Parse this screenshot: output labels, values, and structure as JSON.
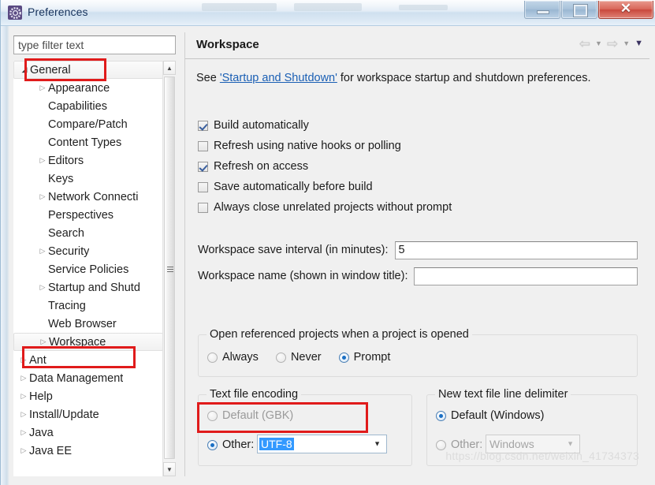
{
  "window": {
    "title": "Preferences",
    "icon": "eclipse-gear-icon",
    "buttons": {
      "minimize": "minimize-button",
      "maximize": "maximize-button",
      "close": "✕"
    }
  },
  "filter": {
    "placeholder": "type filter text",
    "value": ""
  },
  "tree": {
    "items": [
      {
        "label": "General",
        "depth": 0,
        "arrow": "expanded",
        "selected": true,
        "annotated": true
      },
      {
        "label": "Appearance",
        "depth": 1,
        "arrow": "collapsed",
        "selected": false,
        "annotated": false
      },
      {
        "label": "Capabilities",
        "depth": 1,
        "arrow": "none",
        "selected": false,
        "annotated": false
      },
      {
        "label": "Compare/Patch",
        "depth": 1,
        "arrow": "none",
        "selected": false,
        "annotated": false
      },
      {
        "label": "Content Types",
        "depth": 1,
        "arrow": "none",
        "selected": false,
        "annotated": false
      },
      {
        "label": "Editors",
        "depth": 1,
        "arrow": "collapsed",
        "selected": false,
        "annotated": false
      },
      {
        "label": "Keys",
        "depth": 1,
        "arrow": "none",
        "selected": false,
        "annotated": false
      },
      {
        "label": "Network Connecti",
        "depth": 1,
        "arrow": "collapsed",
        "selected": false,
        "annotated": false
      },
      {
        "label": "Perspectives",
        "depth": 1,
        "arrow": "none",
        "selected": false,
        "annotated": false
      },
      {
        "label": "Search",
        "depth": 1,
        "arrow": "none",
        "selected": false,
        "annotated": false
      },
      {
        "label": "Security",
        "depth": 1,
        "arrow": "collapsed",
        "selected": false,
        "annotated": false
      },
      {
        "label": "Service Policies",
        "depth": 1,
        "arrow": "none",
        "selected": false,
        "annotated": false
      },
      {
        "label": "Startup and Shutd",
        "depth": 1,
        "arrow": "collapsed",
        "selected": false,
        "annotated": false
      },
      {
        "label": "Tracing",
        "depth": 1,
        "arrow": "none",
        "selected": false,
        "annotated": false
      },
      {
        "label": "Web Browser",
        "depth": 1,
        "arrow": "none",
        "selected": false,
        "annotated": false
      },
      {
        "label": "Workspace",
        "depth": 1,
        "arrow": "collapsed",
        "selected": true,
        "annotated": true
      },
      {
        "label": "Ant",
        "depth": 0,
        "arrow": "collapsed",
        "selected": false,
        "annotated": false
      },
      {
        "label": "Data Management",
        "depth": 0,
        "arrow": "collapsed",
        "selected": false,
        "annotated": false
      },
      {
        "label": "Help",
        "depth": 0,
        "arrow": "collapsed",
        "selected": false,
        "annotated": false
      },
      {
        "label": "Install/Update",
        "depth": 0,
        "arrow": "collapsed",
        "selected": false,
        "annotated": false
      },
      {
        "label": "Java",
        "depth": 0,
        "arrow": "collapsed",
        "selected": false,
        "annotated": false
      },
      {
        "label": "Java EE",
        "depth": 0,
        "arrow": "collapsed",
        "selected": false,
        "annotated": false
      }
    ]
  },
  "panel": {
    "title": "Workspace",
    "nav": {
      "back": "⇦",
      "back_caret": "▼",
      "forward": "⇨",
      "forward_caret": "▼",
      "menu_caret": "▼"
    },
    "see_prefix": "See ",
    "see_link": "'Startup and Shutdown'",
    "see_suffix": " for workspace startup and shutdown preferences.",
    "checkboxes": [
      {
        "label": "Build automatically",
        "checked": true
      },
      {
        "label": "Refresh using native hooks or polling",
        "checked": false
      },
      {
        "label": "Refresh on access",
        "checked": true
      },
      {
        "label": "Save automatically before build",
        "checked": false
      },
      {
        "label": "Always close unrelated projects without prompt",
        "checked": false
      }
    ],
    "fields": [
      {
        "label": "Workspace save interval (in minutes):",
        "value": "5"
      },
      {
        "label": "Workspace name (shown in window title):",
        "value": ""
      }
    ],
    "open_referenced": {
      "title": "Open referenced projects when a project is opened",
      "options": [
        {
          "label": "Always",
          "selected": false
        },
        {
          "label": "Never",
          "selected": false
        },
        {
          "label": "Prompt",
          "selected": true
        }
      ]
    },
    "text_file_encoding": {
      "title": "Text file encoding",
      "default_label": "Default (GBK)",
      "default_selected": false,
      "other_label": "Other:",
      "other_selected": true,
      "other_value": "UTF-8",
      "annotated": true
    },
    "line_delimiter": {
      "title": "New text file line delimiter",
      "default_label": "Default (Windows)",
      "default_selected": true,
      "other_label": "Other:",
      "other_selected": false,
      "other_value": "Windows"
    }
  },
  "watermark": "https://blog.csdn.net/weixin_41734373",
  "colors": {
    "annotation_red": "#e01b1b",
    "link_blue": "#1a5fb4",
    "selection_blue": "#3399ff",
    "panel_bg": "#f0f0f0"
  }
}
